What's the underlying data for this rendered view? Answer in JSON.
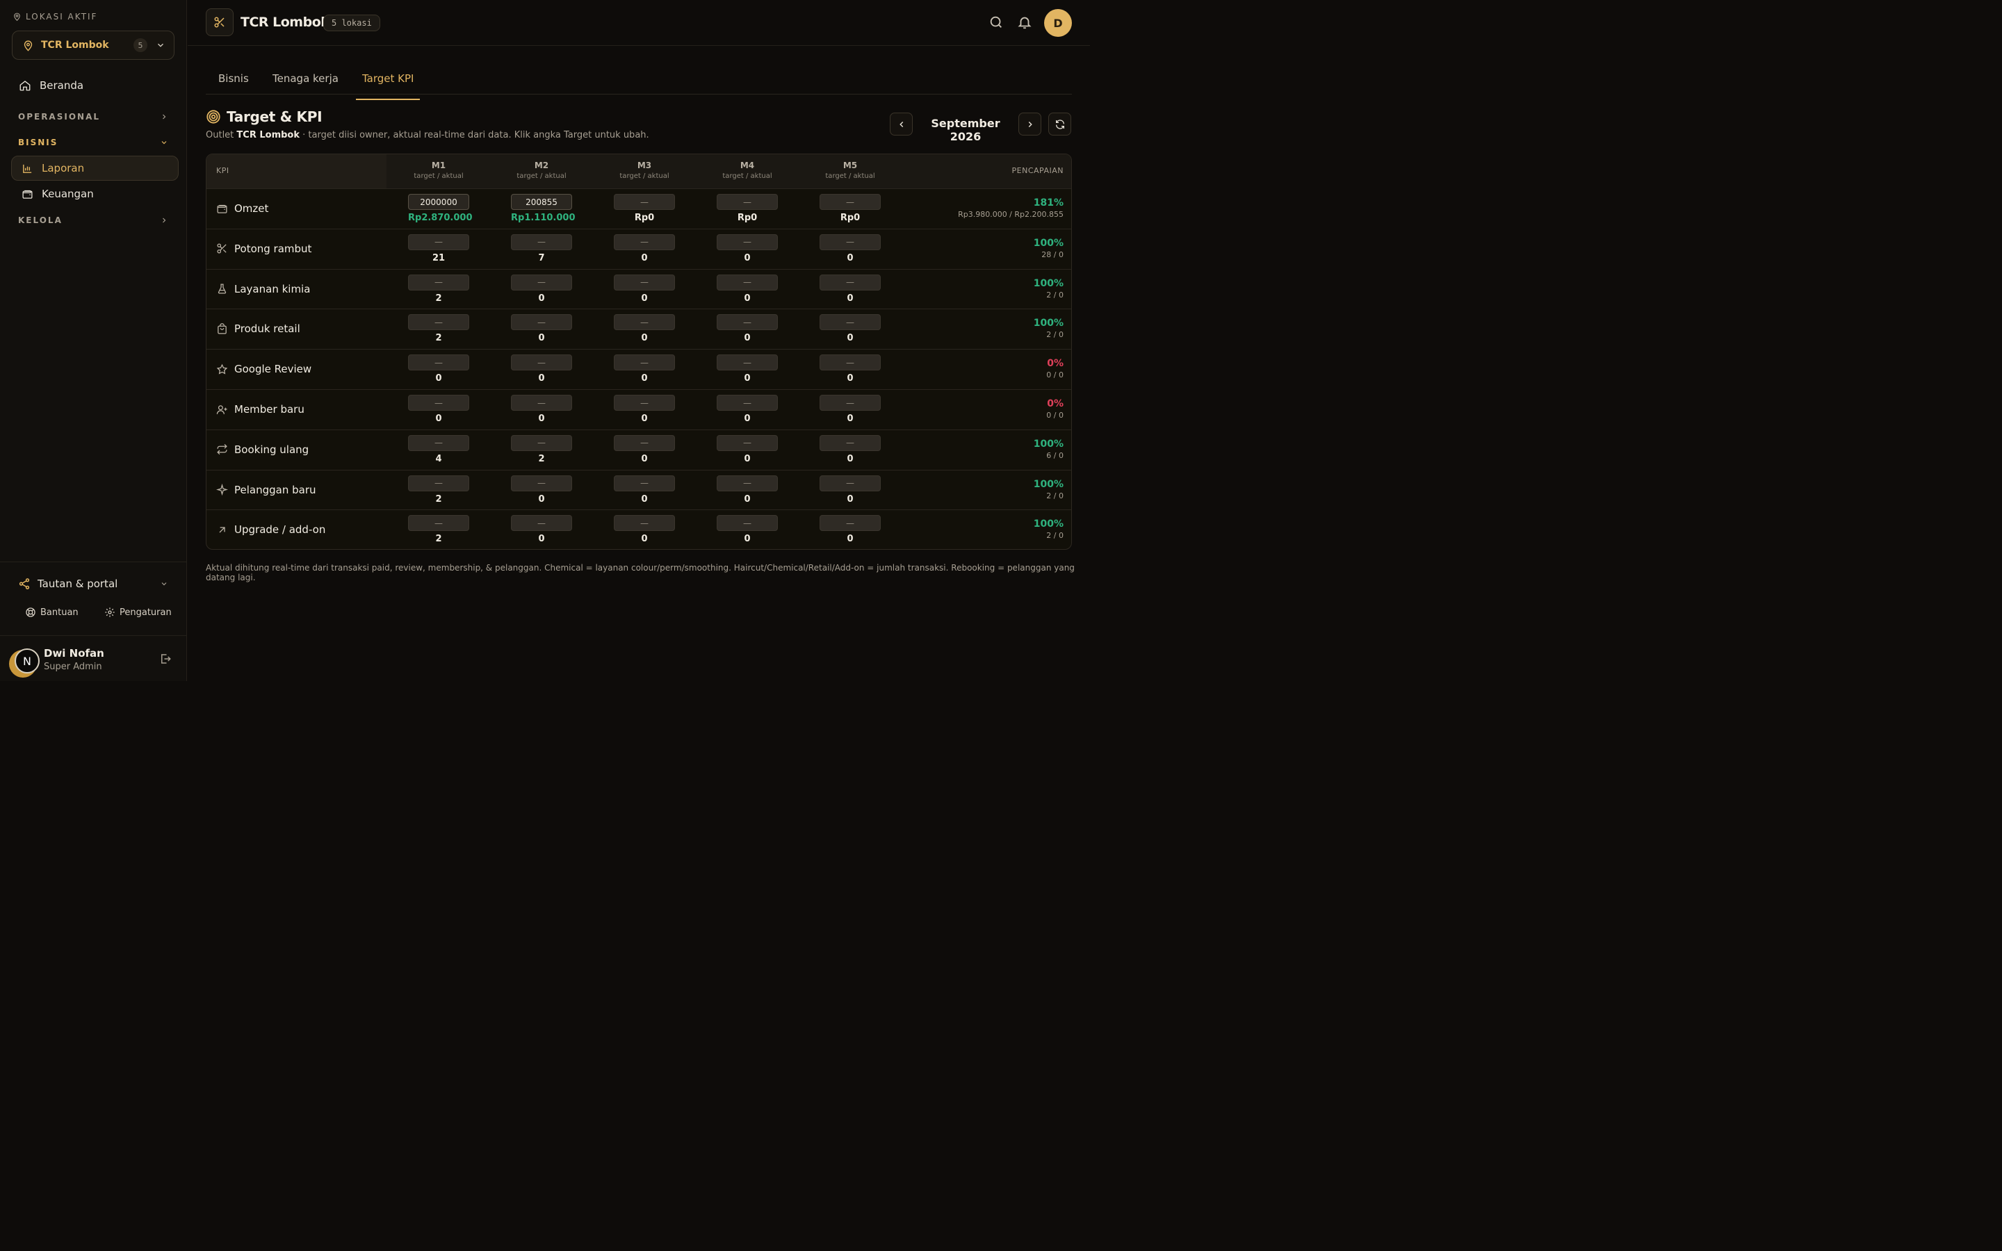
{
  "sidebar": {
    "location_label": "LOKASI AKTIF",
    "location_name": "TCR Lombok",
    "location_count": "5",
    "home": "Beranda",
    "sections": {
      "operasional": "OPERASIONAL",
      "bisnis": "BISNIS",
      "kelola": "KELOLA"
    },
    "bisnis_items": [
      "Laporan",
      "Keuangan"
    ],
    "links": "Tautan & portal",
    "help": "Bantuan",
    "settings": "Pengaturan",
    "user": {
      "initial": "N",
      "name": "Dwi Nofan",
      "role": "Super Admin"
    }
  },
  "topbar": {
    "title": "TCR Lombok",
    "pill": "5 lokasi",
    "avatar": "D"
  },
  "tabs": [
    "Bisnis",
    "Tenaga kerja",
    "Target KPI"
  ],
  "active_tab": "Target KPI",
  "heading": {
    "title": "Target & KPI",
    "sub_prefix": "Outlet",
    "sub_outlet": "TCR Lombok",
    "sub_suffix": "· target diisi owner, aktual real-time dari data. Klik angka Target untuk ubah.",
    "month": "September 2026"
  },
  "table": {
    "kpi_header": "KPI",
    "achievement_header": "PENCAPAIAN",
    "columns": [
      {
        "name": "M1",
        "sub": "target / aktual"
      },
      {
        "name": "M2",
        "sub": "target / aktual"
      },
      {
        "name": "M3",
        "sub": "target / aktual"
      },
      {
        "name": "M4",
        "sub": "target / aktual"
      },
      {
        "name": "M5",
        "sub": "target / aktual"
      }
    ],
    "rows": [
      {
        "icon": "wallet-icon",
        "label": "Omzet",
        "cells": [
          {
            "target": "2000000",
            "actual": "Rp2.870.000"
          },
          {
            "target": "200855",
            "actual": "Rp1.110.000"
          },
          {
            "target": "—",
            "actual": "Rp0"
          },
          {
            "target": "—",
            "actual": "Rp0"
          },
          {
            "target": "—",
            "actual": "Rp0"
          }
        ],
        "pct": "181%",
        "ratio": "Rp3.980.000 / Rp2.200.855"
      },
      {
        "icon": "scissors-icon",
        "label": "Potong rambut",
        "cells": [
          {
            "target": "—",
            "actual": "21"
          },
          {
            "target": "—",
            "actual": "7"
          },
          {
            "target": "—",
            "actual": "0"
          },
          {
            "target": "—",
            "actual": "0"
          },
          {
            "target": "—",
            "actual": "0"
          }
        ],
        "pct": "100%",
        "ratio": "28 / 0"
      },
      {
        "icon": "flask-icon",
        "label": "Layanan kimia",
        "cells": [
          {
            "target": "—",
            "actual": "2"
          },
          {
            "target": "—",
            "actual": "0"
          },
          {
            "target": "—",
            "actual": "0"
          },
          {
            "target": "—",
            "actual": "0"
          },
          {
            "target": "—",
            "actual": "0"
          }
        ],
        "pct": "100%",
        "ratio": "2 / 0"
      },
      {
        "icon": "shopping-bag-icon",
        "label": "Produk retail",
        "cells": [
          {
            "target": "—",
            "actual": "2"
          },
          {
            "target": "—",
            "actual": "0"
          },
          {
            "target": "—",
            "actual": "0"
          },
          {
            "target": "—",
            "actual": "0"
          },
          {
            "target": "—",
            "actual": "0"
          }
        ],
        "pct": "100%",
        "ratio": "2 / 0"
      },
      {
        "icon": "star-icon",
        "label": "Google Review",
        "cells": [
          {
            "target": "—",
            "actual": "0"
          },
          {
            "target": "—",
            "actual": "0"
          },
          {
            "target": "—",
            "actual": "0"
          },
          {
            "target": "—",
            "actual": "0"
          },
          {
            "target": "—",
            "actual": "0"
          }
        ],
        "pct": "0%",
        "ratio": "0 / 0"
      },
      {
        "icon": "user-plus-icon",
        "label": "Member baru",
        "cells": [
          {
            "target": "—",
            "actual": "0"
          },
          {
            "target": "—",
            "actual": "0"
          },
          {
            "target": "—",
            "actual": "0"
          },
          {
            "target": "—",
            "actual": "0"
          },
          {
            "target": "—",
            "actual": "0"
          }
        ],
        "pct": "0%",
        "ratio": "0 / 0"
      },
      {
        "icon": "repeat-icon",
        "label": "Booking ulang",
        "cells": [
          {
            "target": "—",
            "actual": "4"
          },
          {
            "target": "—",
            "actual": "2"
          },
          {
            "target": "—",
            "actual": "0"
          },
          {
            "target": "—",
            "actual": "0"
          },
          {
            "target": "—",
            "actual": "0"
          }
        ],
        "pct": "100%",
        "ratio": "6 / 0"
      },
      {
        "icon": "sparkle-icon",
        "label": "Pelanggan baru",
        "cells": [
          {
            "target": "—",
            "actual": "2"
          },
          {
            "target": "—",
            "actual": "0"
          },
          {
            "target": "—",
            "actual": "0"
          },
          {
            "target": "—",
            "actual": "0"
          },
          {
            "target": "—",
            "actual": "0"
          }
        ],
        "pct": "100%",
        "ratio": "2 / 0"
      },
      {
        "icon": "arrow-up-right-icon",
        "label": "Upgrade / add-on",
        "cells": [
          {
            "target": "—",
            "actual": "2"
          },
          {
            "target": "—",
            "actual": "0"
          },
          {
            "target": "—",
            "actual": "0"
          },
          {
            "target": "—",
            "actual": "0"
          },
          {
            "target": "—",
            "actual": "0"
          }
        ],
        "pct": "100%",
        "ratio": "2 / 0"
      }
    ]
  },
  "footnote": "Aktual dihitung real-time dari transaksi paid, review, membership, & pelanggan. Chemical = layanan colour/perm/smoothing. Haircut/Chemical/Retail/Add-on = jumlah transaksi. Rebooking = pelanggan yang datang lagi.",
  "colors": {
    "accent": "#e2b562",
    "positive": "#2fb37f",
    "negative": "#e0405a",
    "background": "#0e0c0a"
  }
}
